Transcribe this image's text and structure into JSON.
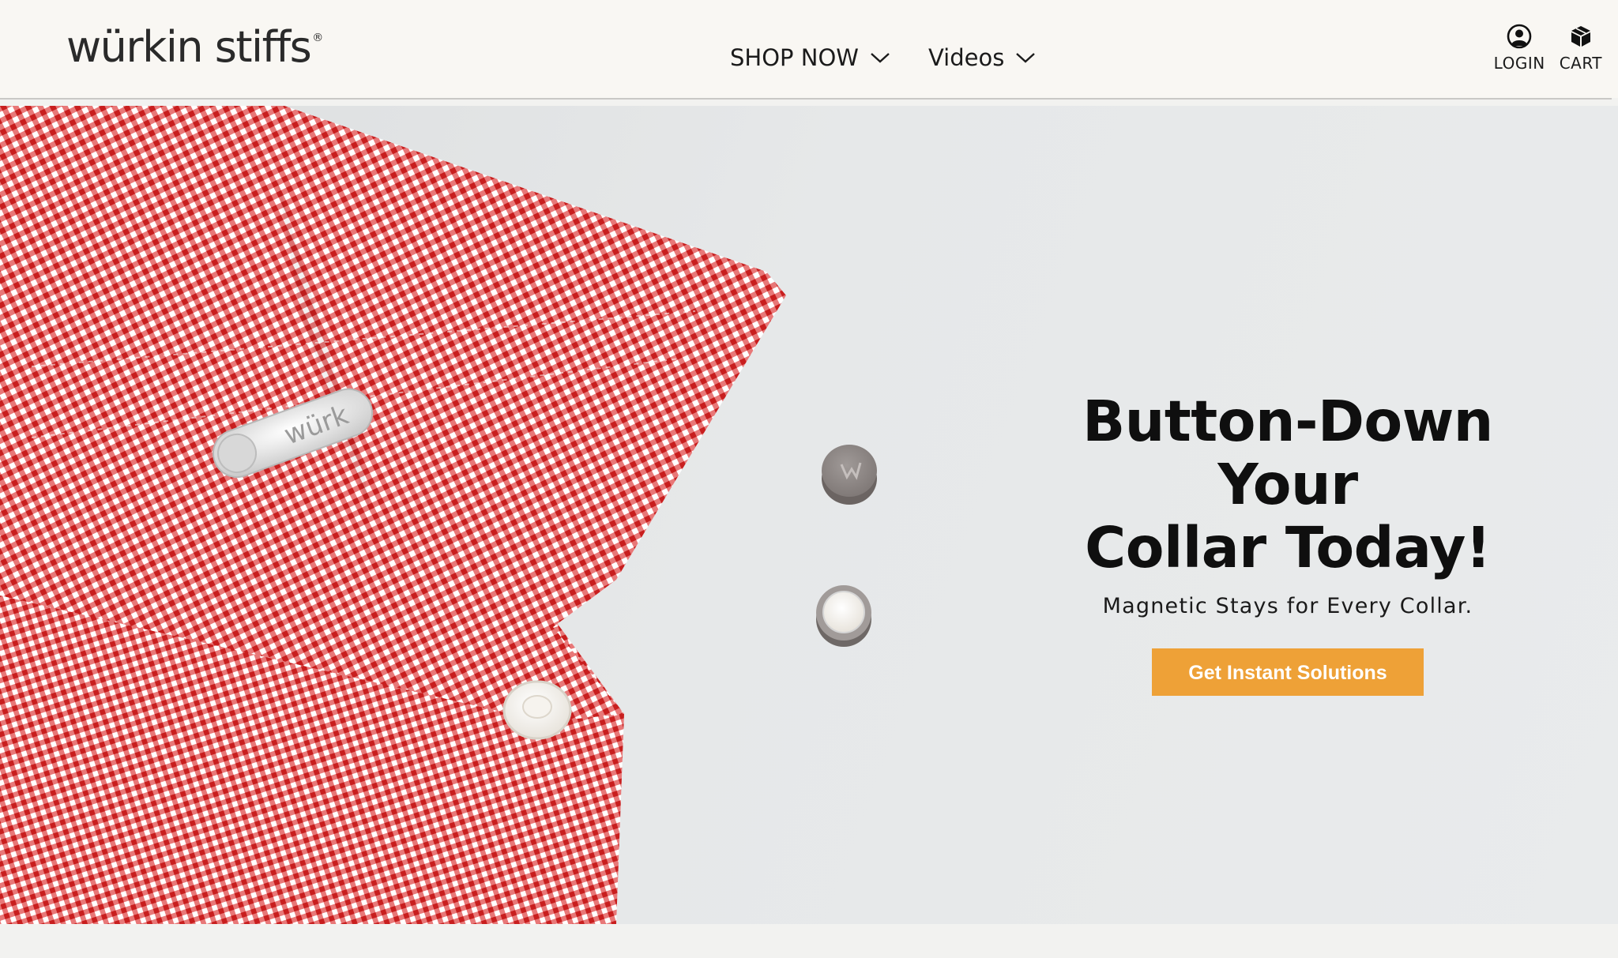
{
  "header": {
    "logo_text": "würkin stiffs",
    "logo_mark": "®",
    "nav": [
      {
        "label": "SHOP NOW",
        "icon": "chevron-down-icon"
      },
      {
        "label": "Videos",
        "icon": "chevron-down-icon"
      }
    ],
    "account": {
      "login_label": "LOGIN",
      "login_icon": "user-circle-icon",
      "cart_label": "CART",
      "cart_icon": "box-icon"
    }
  },
  "hero": {
    "title_line1": "Button-Down Your",
    "title_line2": "Collar Today!",
    "subtitle": "Magnetic Stays for Every Collar.",
    "cta_label": "Get Instant Solutions",
    "stay_engraving": "würk",
    "accent_color": "#eea137",
    "shirt_color": "#d62b2b"
  }
}
